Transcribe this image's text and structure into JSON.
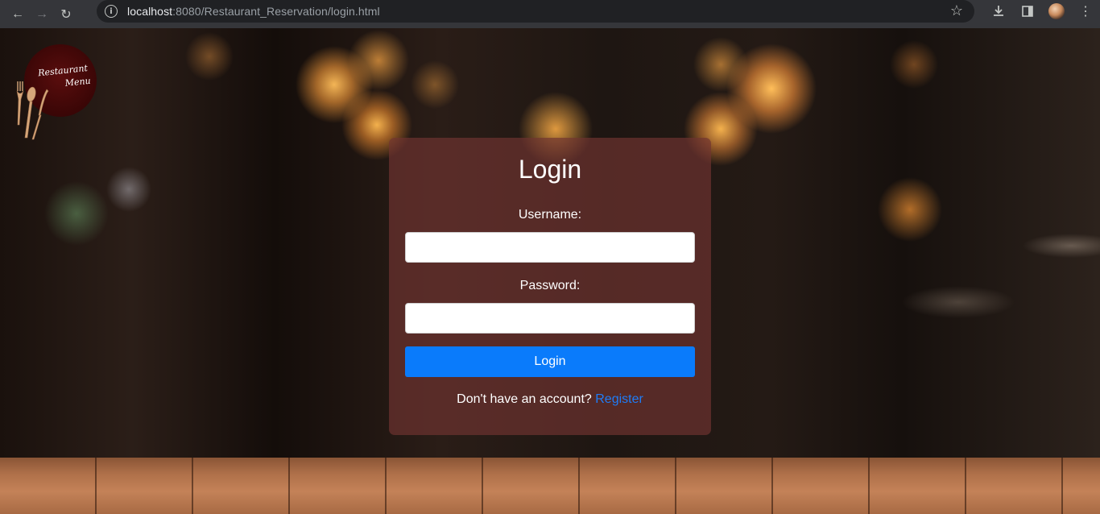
{
  "browser": {
    "url_host": "localhost",
    "url_rest": ":8080/Restaurant_Reservation/login.html"
  },
  "logo": {
    "line1": "Restaurant",
    "line2": "Menu"
  },
  "login": {
    "title": "Login",
    "username_label": "Username:",
    "username_value": "",
    "password_label": "Password:",
    "password_value": "",
    "submit_label": "Login",
    "register_prompt": "Don't have an account?",
    "register_link": "Register"
  },
  "colors": {
    "button": "#0a7bfb",
    "link": "#1f7cf6",
    "card": "rgba(112,52,48,0.68)"
  }
}
